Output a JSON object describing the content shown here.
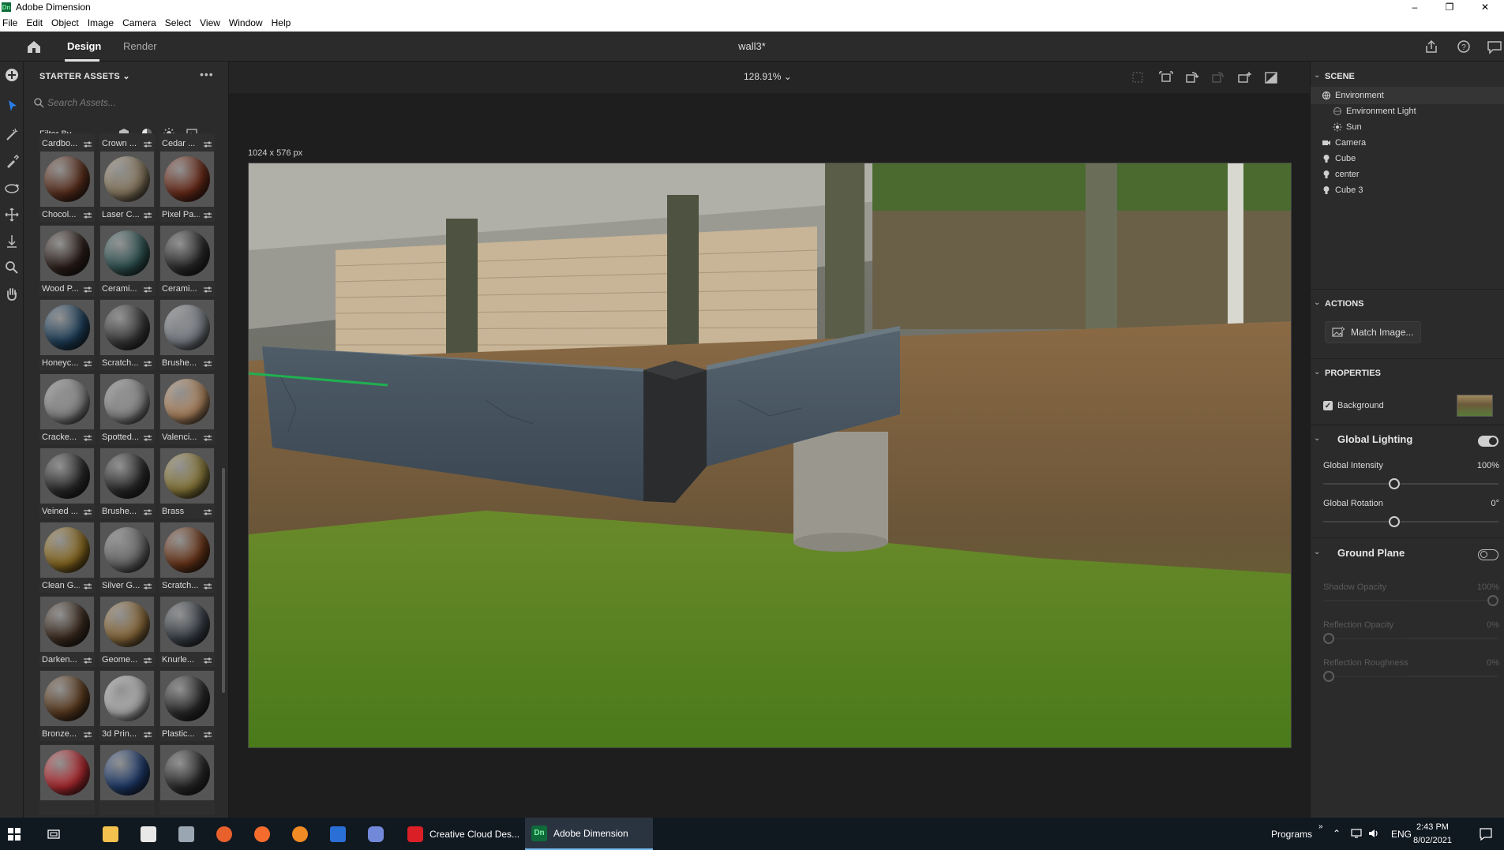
{
  "window": {
    "title": "Adobe Dimension",
    "app_icon": "Dn",
    "controls": [
      "minimize-icon",
      "restore-icon",
      "close-icon"
    ]
  },
  "menu": [
    "File",
    "Edit",
    "Object",
    "Image",
    "Camera",
    "Select",
    "View",
    "Window",
    "Help"
  ],
  "header": {
    "tabs": [
      {
        "label": "Design",
        "active": true
      },
      {
        "label": "Render",
        "active": false
      }
    ],
    "document_title": "wall3*",
    "right_icons": [
      "share-icon",
      "help-icon",
      "feedback-icon"
    ]
  },
  "tools": [
    "add-icon",
    "select-icon",
    "magic-wand-icon",
    "sampler-icon",
    "orbit-icon",
    "pan-icon",
    "dolly-icon",
    "zoom-icon",
    "hand-icon"
  ],
  "assets": {
    "panel_title": "STARTER ASSETS",
    "search_placeholder": "Search Assets...",
    "filter_label": "Filter By",
    "filter_icons": [
      "model-filter-icon",
      "material-filter-icon",
      "light-filter-icon",
      "image-filter-icon"
    ],
    "partial_row": [
      "Cardbo...",
      "Crown ...",
      "Cedar ..."
    ],
    "items": [
      {
        "label": "Chocol...",
        "color": "#5a2e1c"
      },
      {
        "label": "Laser C...",
        "color": "#8a7a60"
      },
      {
        "label": "Pixel Pa...",
        "color": "#6a2a18"
      },
      {
        "label": "Wood P...",
        "color": "#2c1e1a"
      },
      {
        "label": "Cerami...",
        "color": "#2f5352"
      },
      {
        "label": "Cerami...",
        "color": "#2a2a2a"
      },
      {
        "label": "Honeyc...",
        "color": "#1e3f5a"
      },
      {
        "label": "Scratch...",
        "color": "#3a3a3a"
      },
      {
        "label": "Brushe...",
        "color": "#7a7f87"
      },
      {
        "label": "Cracke...",
        "color": "#8a8a8a"
      },
      {
        "label": "Spotted...",
        "color": "#8c8c8c"
      },
      {
        "label": "Valenci...",
        "color": "#b08660"
      },
      {
        "label": "Veined ...",
        "color": "#2a2a2a"
      },
      {
        "label": "Brushe...",
        "color": "#2a2a2a"
      },
      {
        "label": "Brass",
        "color": "#8a7a3a"
      },
      {
        "label": "Clean G...",
        "color": "#8a6a20"
      },
      {
        "label": "Silver G...",
        "color": "#6a6a6a"
      },
      {
        "label": "Scratch...",
        "color": "#6a3518"
      },
      {
        "label": "Darken...",
        "color": "#3a2a1e"
      },
      {
        "label": "Geome...",
        "color": "#8a6a3a"
      },
      {
        "label": "Knurle...",
        "color": "#3a4048"
      },
      {
        "label": "Bronze...",
        "color": "#5a3a1e"
      },
      {
        "label": "3d Prin...",
        "color": "#b0b0b0"
      },
      {
        "label": "Plastic...",
        "color": "#2a2a2a"
      },
      {
        "label": "",
        "color": "#b02a30"
      },
      {
        "label": "",
        "color": "#1e3a6a"
      },
      {
        "label": "",
        "color": "#2a2a2a"
      }
    ]
  },
  "viewport": {
    "zoom": "128.91%",
    "canvas_size": "1024 x 576 px",
    "toolbar_icons": [
      "frame-icon",
      "fit-selection-icon",
      "rotate-icon",
      "orbit-view-icon",
      "camera-bookmark-icon",
      "render-preview-icon"
    ]
  },
  "scene": {
    "title": "SCENE",
    "items": [
      {
        "label": "Environment",
        "indent": 0,
        "icon": "environment-icon",
        "selected": true
      },
      {
        "label": "Environment Light",
        "indent": 1,
        "icon": "environment-light-icon"
      },
      {
        "label": "Sun",
        "indent": 1,
        "icon": "sun-icon"
      },
      {
        "label": "Camera",
        "indent": 0,
        "icon": "camera-icon"
      },
      {
        "label": "Cube",
        "indent": 0,
        "icon": "object-icon"
      },
      {
        "label": "center",
        "indent": 0,
        "icon": "object-icon"
      },
      {
        "label": "Cube 3",
        "indent": 0,
        "icon": "object-icon"
      }
    ]
  },
  "actions": {
    "title": "ACTIONS",
    "match_image": "Match Image..."
  },
  "properties": {
    "title": "PROPERTIES",
    "background_label": "Background",
    "background_checked": true,
    "global_lighting": {
      "title": "Global Lighting",
      "enabled": true,
      "intensity_label": "Global Intensity",
      "intensity_value": "100%",
      "intensity_fraction": 0.4,
      "rotation_label": "Global Rotation",
      "rotation_value": "0°",
      "rotation_fraction": 0.4
    },
    "ground_plane": {
      "title": "Ground Plane",
      "enabled": false,
      "shadow_opacity_label": "Shadow Opacity",
      "shadow_opacity_value": "100%",
      "reflection_opacity_label": "Reflection Opacity",
      "reflection_opacity_value": "0%",
      "reflection_roughness_label": "Reflection Roughness",
      "reflection_roughness_value": "0%"
    }
  },
  "taskbar": {
    "apps": [
      {
        "label": "Creative Cloud Des...",
        "active": false
      },
      {
        "label": "Adobe Dimension",
        "active": true
      }
    ],
    "programs_label": "Programs",
    "lang": "ENG",
    "time": "2:43 PM",
    "date": "8/02/2021"
  },
  "colors": {
    "accent": "#2680eb",
    "panel": "#2b2b2b",
    "taskbar": "#101820",
    "dimension_green": "#0f6b3a"
  }
}
